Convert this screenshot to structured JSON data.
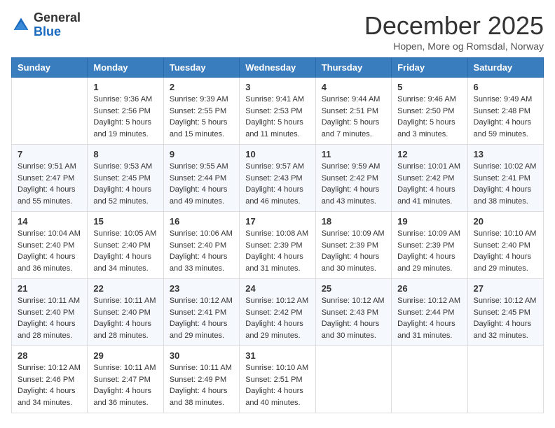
{
  "logo": {
    "general": "General",
    "blue": "Blue"
  },
  "title": "December 2025",
  "subtitle": "Hopen, More og Romsdal, Norway",
  "headers": [
    "Sunday",
    "Monday",
    "Tuesday",
    "Wednesday",
    "Thursday",
    "Friday",
    "Saturday"
  ],
  "weeks": [
    [
      {
        "day": "",
        "info": ""
      },
      {
        "day": "1",
        "info": "Sunrise: 9:36 AM\nSunset: 2:56 PM\nDaylight: 5 hours\nand 19 minutes."
      },
      {
        "day": "2",
        "info": "Sunrise: 9:39 AM\nSunset: 2:55 PM\nDaylight: 5 hours\nand 15 minutes."
      },
      {
        "day": "3",
        "info": "Sunrise: 9:41 AM\nSunset: 2:53 PM\nDaylight: 5 hours\nand 11 minutes."
      },
      {
        "day": "4",
        "info": "Sunrise: 9:44 AM\nSunset: 2:51 PM\nDaylight: 5 hours\nand 7 minutes."
      },
      {
        "day": "5",
        "info": "Sunrise: 9:46 AM\nSunset: 2:50 PM\nDaylight: 5 hours\nand 3 minutes."
      },
      {
        "day": "6",
        "info": "Sunrise: 9:49 AM\nSunset: 2:48 PM\nDaylight: 4 hours\nand 59 minutes."
      }
    ],
    [
      {
        "day": "7",
        "info": "Sunrise: 9:51 AM\nSunset: 2:47 PM\nDaylight: 4 hours\nand 55 minutes."
      },
      {
        "day": "8",
        "info": "Sunrise: 9:53 AM\nSunset: 2:45 PM\nDaylight: 4 hours\nand 52 minutes."
      },
      {
        "day": "9",
        "info": "Sunrise: 9:55 AM\nSunset: 2:44 PM\nDaylight: 4 hours\nand 49 minutes."
      },
      {
        "day": "10",
        "info": "Sunrise: 9:57 AM\nSunset: 2:43 PM\nDaylight: 4 hours\nand 46 minutes."
      },
      {
        "day": "11",
        "info": "Sunrise: 9:59 AM\nSunset: 2:42 PM\nDaylight: 4 hours\nand 43 minutes."
      },
      {
        "day": "12",
        "info": "Sunrise: 10:01 AM\nSunset: 2:42 PM\nDaylight: 4 hours\nand 41 minutes."
      },
      {
        "day": "13",
        "info": "Sunrise: 10:02 AM\nSunset: 2:41 PM\nDaylight: 4 hours\nand 38 minutes."
      }
    ],
    [
      {
        "day": "14",
        "info": "Sunrise: 10:04 AM\nSunset: 2:40 PM\nDaylight: 4 hours\nand 36 minutes."
      },
      {
        "day": "15",
        "info": "Sunrise: 10:05 AM\nSunset: 2:40 PM\nDaylight: 4 hours\nand 34 minutes."
      },
      {
        "day": "16",
        "info": "Sunrise: 10:06 AM\nSunset: 2:40 PM\nDaylight: 4 hours\nand 33 minutes."
      },
      {
        "day": "17",
        "info": "Sunrise: 10:08 AM\nSunset: 2:39 PM\nDaylight: 4 hours\nand 31 minutes."
      },
      {
        "day": "18",
        "info": "Sunrise: 10:09 AM\nSunset: 2:39 PM\nDaylight: 4 hours\nand 30 minutes."
      },
      {
        "day": "19",
        "info": "Sunrise: 10:09 AM\nSunset: 2:39 PM\nDaylight: 4 hours\nand 29 minutes."
      },
      {
        "day": "20",
        "info": "Sunrise: 10:10 AM\nSunset: 2:40 PM\nDaylight: 4 hours\nand 29 minutes."
      }
    ],
    [
      {
        "day": "21",
        "info": "Sunrise: 10:11 AM\nSunset: 2:40 PM\nDaylight: 4 hours\nand 28 minutes."
      },
      {
        "day": "22",
        "info": "Sunrise: 10:11 AM\nSunset: 2:40 PM\nDaylight: 4 hours\nand 28 minutes."
      },
      {
        "day": "23",
        "info": "Sunrise: 10:12 AM\nSunset: 2:41 PM\nDaylight: 4 hours\nand 29 minutes."
      },
      {
        "day": "24",
        "info": "Sunrise: 10:12 AM\nSunset: 2:42 PM\nDaylight: 4 hours\nand 29 minutes."
      },
      {
        "day": "25",
        "info": "Sunrise: 10:12 AM\nSunset: 2:43 PM\nDaylight: 4 hours\nand 30 minutes."
      },
      {
        "day": "26",
        "info": "Sunrise: 10:12 AM\nSunset: 2:44 PM\nDaylight: 4 hours\nand 31 minutes."
      },
      {
        "day": "27",
        "info": "Sunrise: 10:12 AM\nSunset: 2:45 PM\nDaylight: 4 hours\nand 32 minutes."
      }
    ],
    [
      {
        "day": "28",
        "info": "Sunrise: 10:12 AM\nSunset: 2:46 PM\nDaylight: 4 hours\nand 34 minutes."
      },
      {
        "day": "29",
        "info": "Sunrise: 10:11 AM\nSunset: 2:47 PM\nDaylight: 4 hours\nand 36 minutes."
      },
      {
        "day": "30",
        "info": "Sunrise: 10:11 AM\nSunset: 2:49 PM\nDaylight: 4 hours\nand 38 minutes."
      },
      {
        "day": "31",
        "info": "Sunrise: 10:10 AM\nSunset: 2:51 PM\nDaylight: 4 hours\nand 40 minutes."
      },
      {
        "day": "",
        "info": ""
      },
      {
        "day": "",
        "info": ""
      },
      {
        "day": "",
        "info": ""
      }
    ]
  ]
}
